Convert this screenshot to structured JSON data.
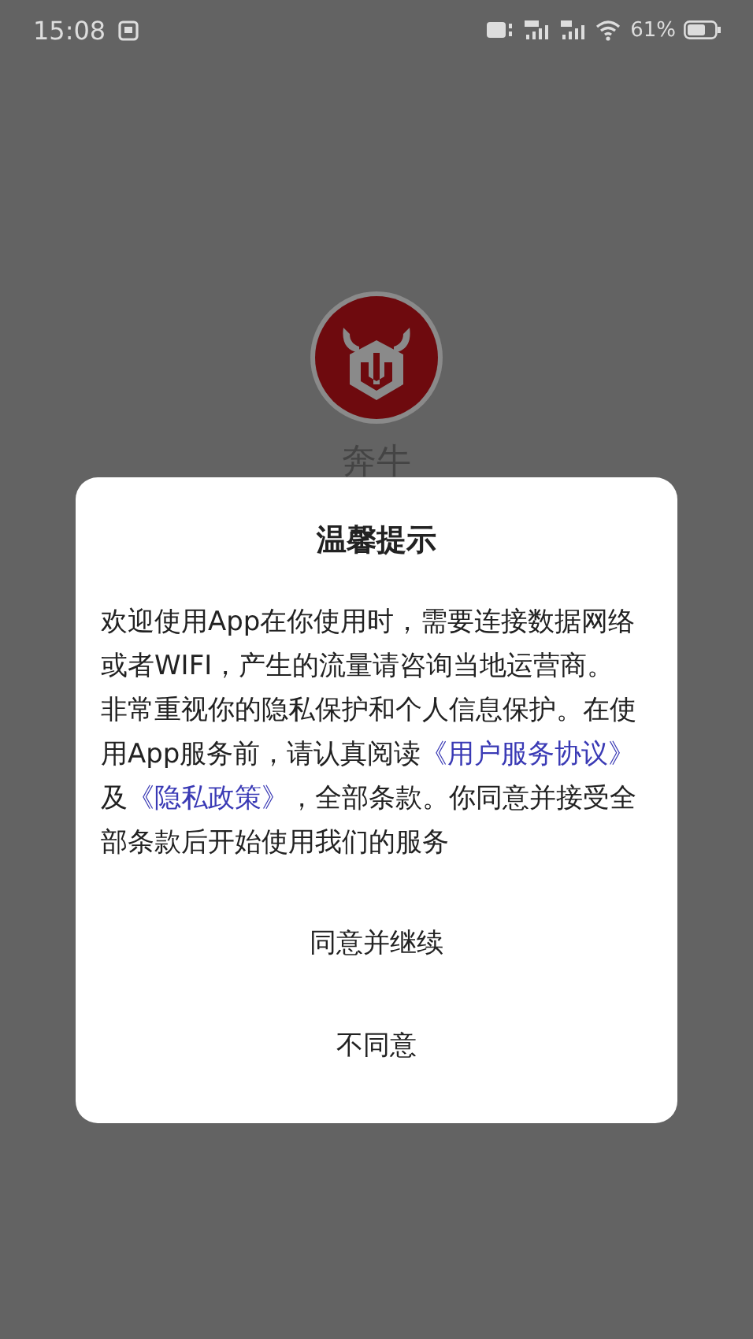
{
  "status_bar": {
    "time": "15:08",
    "battery": "61%"
  },
  "app": {
    "name": "奔牛"
  },
  "dialog": {
    "title": "温馨提示",
    "body": [
      {
        "kind": "text",
        "text": "欢迎使用App在你使用时，需要连接数据网络或者WIFI，产生的流量请咨询当地运营商。非常重视你的隐私保护和个人信息保护。在使用App服务前，请认真阅读"
      },
      {
        "kind": "link",
        "text": "《用户服务协议》"
      },
      {
        "kind": "text",
        "text": "及"
      },
      {
        "kind": "link",
        "text": "《隐私政策》"
      },
      {
        "kind": "text",
        "text": "，全部条款。你同意并接受全部条款后开始使用我们的服务"
      }
    ],
    "buttons": [
      "同意并继续",
      "不同意"
    ]
  }
}
